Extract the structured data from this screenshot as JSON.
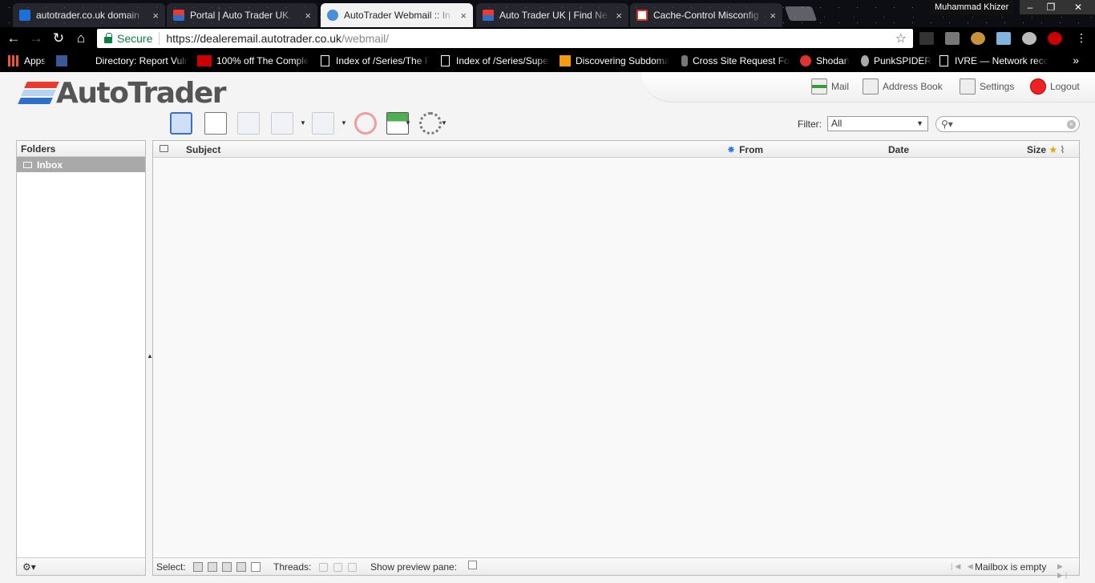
{
  "browser": {
    "tabs": [
      {
        "label": "autotrader.co.uk domain",
        "color": "#1e6fd9"
      },
      {
        "label": "Portal | Auto Trader UK",
        "color": "#e63b2e"
      },
      {
        "label": "AutoTrader Webmail :: In",
        "color": "#4a8fd6"
      },
      {
        "label": "Auto Trader UK | Find Ne",
        "color": "#e63b2e"
      },
      {
        "label": "Cache-Control Misconfig",
        "color": "#d93025"
      }
    ],
    "close_glyph": "×",
    "profile_name": "Muhammad Khizer",
    "window_controls": [
      "‒",
      "❐",
      "✕"
    ],
    "address": {
      "secure_label": "Secure",
      "url_host": "https://dealeremail.autotrader.co.uk",
      "url_path": "/webmail/"
    },
    "bookmarks": [
      {
        "label": "Apps",
        "icon": "apps-grid-icon"
      },
      {
        "label": "",
        "icon": "facebook-icon"
      },
      {
        "label": "Directory: Report Vuln",
        "icon": ""
      },
      {
        "label": "100% off The Comple",
        "icon": "dg-logo-icon"
      },
      {
        "label": "Index of /Series/The F",
        "icon": "document-icon"
      },
      {
        "label": "Index of /Series/Super",
        "icon": "document-icon"
      },
      {
        "label": "Discovering Subdoma",
        "icon": "b-logo-icon"
      },
      {
        "label": "Cross Site Request For",
        "icon": "figure-icon"
      },
      {
        "label": "Shodan",
        "icon": "shodan-icon"
      },
      {
        "label": "PunkSPIDER",
        "icon": "spider-icon"
      },
      {
        "label": "IVRE — Network reco",
        "icon": "document-icon"
      }
    ],
    "bookmarks_more": "»"
  },
  "app": {
    "logo_text": "AutoTrader",
    "logo_colors": [
      "#e63b2e",
      "#8fb7e6",
      "#2e6fc9"
    ],
    "topnav": [
      {
        "label": "Mail",
        "icon": "mail-download-icon"
      },
      {
        "label": "Address Book",
        "icon": "address-book-icon"
      },
      {
        "label": "Settings",
        "icon": "settings-icon"
      },
      {
        "label": "Logout",
        "icon": "logout-icon"
      }
    ],
    "toolbar": {
      "buttons": [
        "refresh-icon",
        "compose-icon",
        "reply-icon",
        "reply-all-icon",
        "forward-icon",
        "delete-icon",
        "mark-icon",
        "more-icon"
      ]
    },
    "filter": {
      "label": "Filter:",
      "selected": "All"
    },
    "search": {
      "placeholder": ""
    },
    "folders": {
      "title": "Folders",
      "items": [
        {
          "label": "Inbox"
        }
      ],
      "footer_menu": "⚙▾"
    },
    "messages": {
      "columns": {
        "subject": "Subject",
        "from": "From",
        "date": "Date",
        "size": "Size"
      },
      "footer": {
        "select_label": "Select:",
        "threads_label": "Threads:",
        "preview_label": "Show preview pane:",
        "status": "Mailbox is empty"
      }
    }
  }
}
